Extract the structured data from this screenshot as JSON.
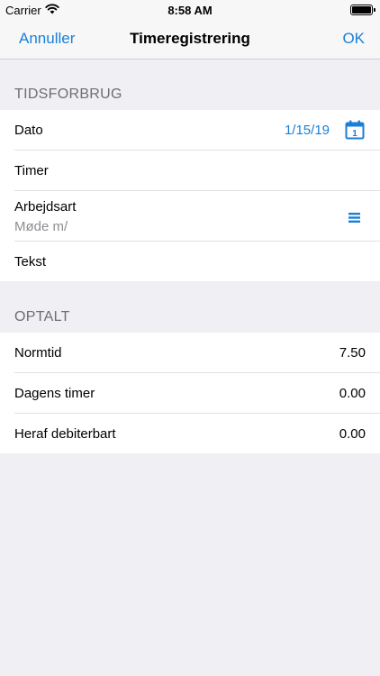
{
  "status_bar": {
    "carrier": "Carrier",
    "time": "8:58 AM"
  },
  "nav": {
    "cancel": "Annuller",
    "title": "Timeregistrering",
    "ok": "OK"
  },
  "sections": {
    "usage": {
      "header": "TIDSFORBRUG",
      "date_label": "Dato",
      "date_value": "1/15/19",
      "calendar_day": "1",
      "hours_label": "Timer",
      "worktype_label": "Arbejdsart",
      "worktype_value": "Møde m/",
      "text_label": "Tekst"
    },
    "counted": {
      "header": "OPTALT",
      "rows": [
        {
          "label": "Normtid",
          "value": "7.50"
        },
        {
          "label": "Dagens timer",
          "value": "0.00"
        },
        {
          "label": "Heraf debiterbart",
          "value": "0.00"
        }
      ]
    }
  },
  "icons": {
    "calendar": "calendar-icon",
    "list": "list-icon",
    "wifi": "wifi-icon",
    "battery": "battery-icon"
  },
  "colors": {
    "accent": "#1a7fd9",
    "background": "#efeff4",
    "secondary_text": "#8e8e93"
  }
}
